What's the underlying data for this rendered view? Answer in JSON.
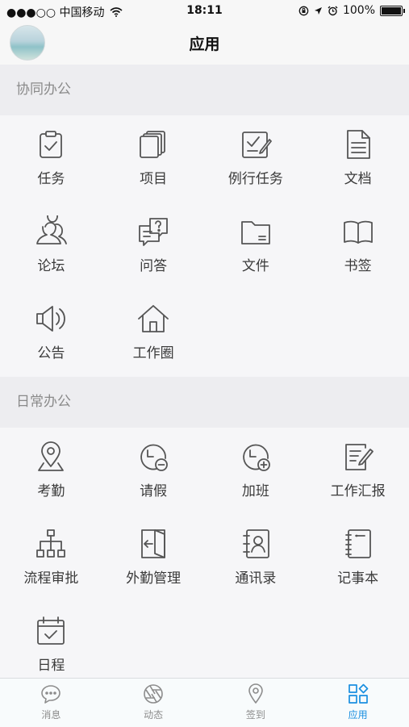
{
  "status_bar": {
    "carrier": "●●●○○ 中国移动",
    "time": "18:11",
    "battery": "100%"
  },
  "nav": {
    "title": "应用"
  },
  "sections": [
    {
      "title": "协同办公",
      "items": [
        {
          "label": "任务",
          "icon": "clipboard-check-icon"
        },
        {
          "label": "项目",
          "icon": "stacked-pages-icon"
        },
        {
          "label": "例行任务",
          "icon": "checklist-edit-icon"
        },
        {
          "label": "文档",
          "icon": "document-icon"
        },
        {
          "label": "论坛",
          "icon": "users-icon"
        },
        {
          "label": "问答",
          "icon": "question-chat-icon"
        },
        {
          "label": "文件",
          "icon": "folder-icon"
        },
        {
          "label": "书签",
          "icon": "open-book-icon"
        },
        {
          "label": "公告",
          "icon": "speaker-icon"
        },
        {
          "label": "工作圈",
          "icon": "home-icon"
        }
      ]
    },
    {
      "title": "日常办公",
      "items": [
        {
          "label": "考勤",
          "icon": "location-pin-icon"
        },
        {
          "label": "请假",
          "icon": "clock-minus-icon"
        },
        {
          "label": "加班",
          "icon": "clock-plus-icon"
        },
        {
          "label": "工作汇报",
          "icon": "report-edit-icon"
        },
        {
          "label": "流程审批",
          "icon": "org-chart-icon"
        },
        {
          "label": "外勤管理",
          "icon": "door-exit-icon"
        },
        {
          "label": "通讯录",
          "icon": "contacts-icon"
        },
        {
          "label": "记事本",
          "icon": "notebook-icon"
        },
        {
          "label": "日程",
          "icon": "calendar-check-icon"
        }
      ]
    }
  ],
  "tabs": [
    {
      "label": "消息",
      "icon": "chat-bubble-icon"
    },
    {
      "label": "动态",
      "icon": "aperture-icon"
    },
    {
      "label": "签到",
      "icon": "map-pin-icon"
    },
    {
      "label": "应用",
      "icon": "apps-grid-icon",
      "active": true
    }
  ],
  "colors": {
    "accent": "#1a8fe0",
    "icon_stroke": "#555555",
    "section_text": "#8a8a8a"
  }
}
